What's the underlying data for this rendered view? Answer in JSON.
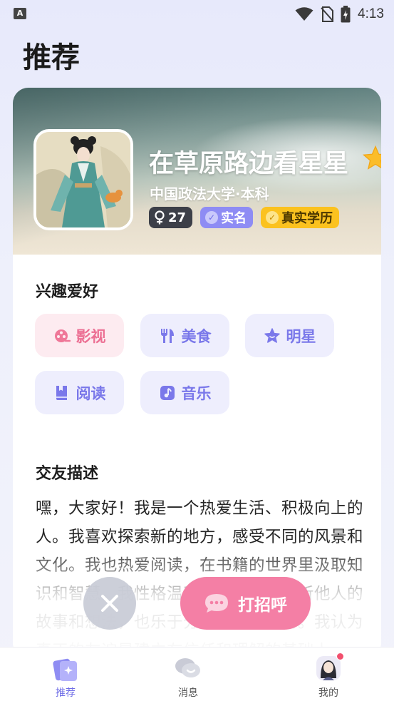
{
  "status_bar": {
    "time": "4:13",
    "app_icon_letter": "A",
    "icons": [
      "wifi-icon",
      "no-sim-icon",
      "battery-charging-icon"
    ]
  },
  "page": {
    "title": "推荐"
  },
  "profile": {
    "name": "在草原路边看星星",
    "school": "中国政法大学·本科",
    "age": "27",
    "gender": "female",
    "badges": {
      "real_name": "实名",
      "education": "真实学历"
    }
  },
  "interests": {
    "title": "兴趣爱好",
    "items": [
      {
        "label": "影视",
        "icon": "film-reel-icon",
        "highlighted": true
      },
      {
        "label": "美食",
        "icon": "fork-knife-icon",
        "highlighted": false
      },
      {
        "label": "明星",
        "icon": "star-icon",
        "highlighted": false
      },
      {
        "label": "阅读",
        "icon": "book-icon",
        "highlighted": false
      },
      {
        "label": "音乐",
        "icon": "music-note-icon",
        "highlighted": false
      }
    ]
  },
  "friendship": {
    "title": "交友描述",
    "text": "嘿，大家好！我是一个热爱生活、积极向上的人。我喜欢探索新的地方，感受不同的风景和文化。我也热爱阅读，在书籍的世界里汲取知识和智慧。我性格温和友善，善于倾听他人的故事和想法，也乐于分享自己的经历。我认为真正的友谊是建立在信任和理解的基础上"
  },
  "actions": {
    "greet_label": "打招呼"
  },
  "bottom_nav": {
    "items": [
      {
        "label": "推荐",
        "icon": "recommend-icon",
        "active": true
      },
      {
        "label": "消息",
        "icon": "message-icon",
        "active": false
      },
      {
        "label": "我的",
        "icon": "profile-avatar-icon",
        "active": false
      }
    ]
  },
  "colors": {
    "accent": "#7a78ea",
    "pink": "#f47fa5",
    "gold": "#fbc21f"
  }
}
